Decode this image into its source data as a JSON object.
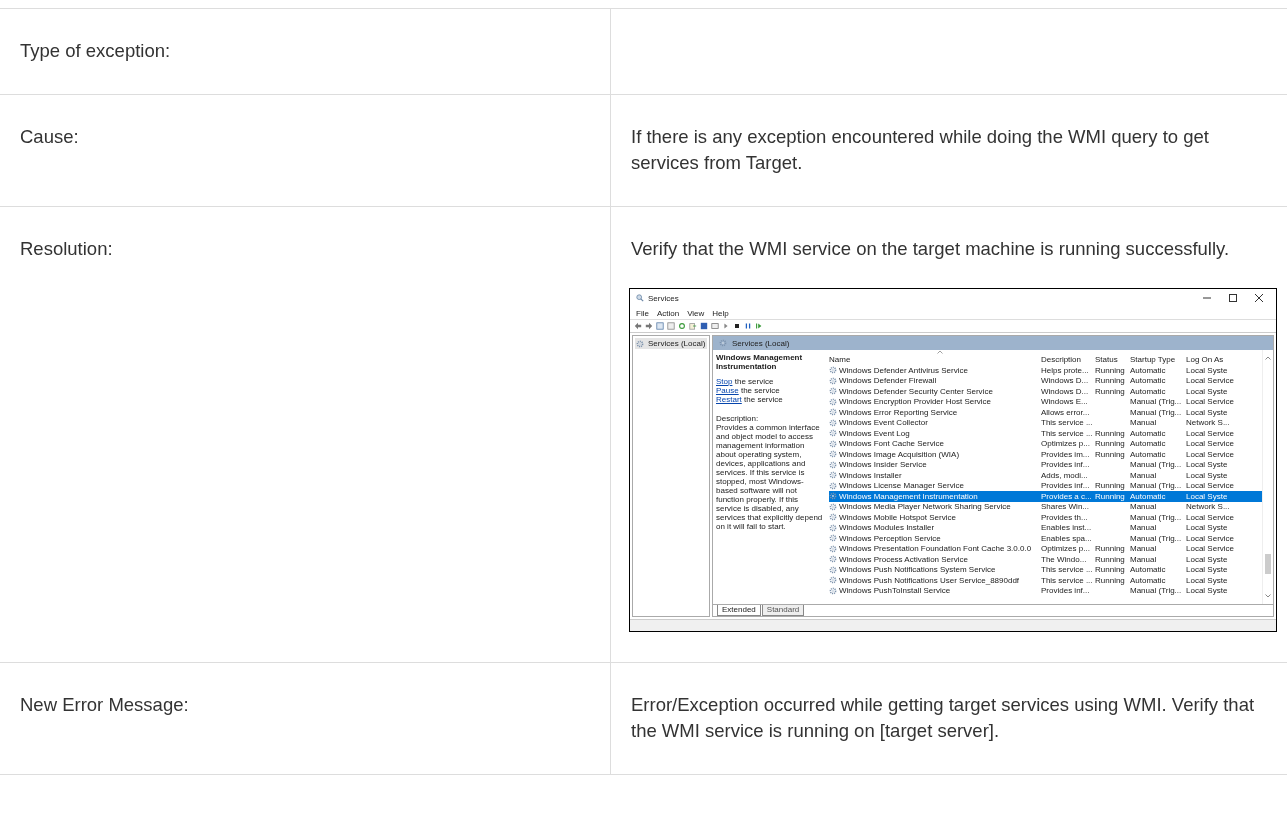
{
  "rows": [
    {
      "label": "Type of exception:"
    },
    {
      "label": "Cause:",
      "text": "If there is any exception encountered while doing the WMI query to get services from Target."
    },
    {
      "label": "Resolution:",
      "text": "Verify that the WMI service on the target machine is running successfully.",
      "screenshot": {
        "title": "Services",
        "menu": [
          "File",
          "Action",
          "View",
          "Help"
        ],
        "tree": [
          "Services (Local)"
        ],
        "header": "Services (Local)",
        "details": {
          "title": "Windows Management Instrumentation",
          "actions": [
            {
              "link": "Stop",
              "text": "the service"
            },
            {
              "link": "Pause",
              "text": "the service"
            },
            {
              "link": "Restart",
              "text": "the service"
            }
          ],
          "description_label": "Description:",
          "description": "Provides a common interface and object model to access management information about operating system, devices, applications and services. If this service is stopped, most Windows-based software will not function properly. If this service is disabled, any services that explicitly depend on it will fail to start."
        },
        "columns": [
          "Name",
          "Description",
          "Status",
          "Startup Type",
          "Log On As"
        ],
        "services": [
          {
            "name": "Windows Defender Antivirus Service",
            "description": "Helps prote...",
            "status": "Running",
            "startup": "Automatic",
            "logon": "Local Syste",
            "selected": false
          },
          {
            "name": "Windows Defender Firewall",
            "description": "Windows D...",
            "status": "Running",
            "startup": "Automatic",
            "logon": "Local Service",
            "selected": false
          },
          {
            "name": "Windows Defender Security Center Service",
            "description": "Windows D...",
            "status": "Running",
            "startup": "Automatic",
            "logon": "Local Syste",
            "selected": false
          },
          {
            "name": "Windows Encryption Provider Host Service",
            "description": "Windows E...",
            "startup": "Manual (Trig...",
            "logon": "Local Service",
            "selected": false
          },
          {
            "name": "Windows Error Reporting Service",
            "description": "Allows error...",
            "startup": "Manual (Trig...",
            "logon": "Local Syste",
            "selected": false
          },
          {
            "name": "Windows Event Collector",
            "description": "This service ...",
            "startup": "Manual",
            "logon": "Network S...",
            "selected": false
          },
          {
            "name": "Windows Event Log",
            "description": "This service ...",
            "status": "Running",
            "startup": "Automatic",
            "logon": "Local Service",
            "selected": false
          },
          {
            "name": "Windows Font Cache Service",
            "description": "Optimizes p...",
            "status": "Running",
            "startup": "Automatic",
            "logon": "Local Service",
            "selected": false
          },
          {
            "name": "Windows Image Acquisition (WIA)",
            "description": "Provides im...",
            "status": "Running",
            "startup": "Automatic",
            "logon": "Local Service",
            "selected": false
          },
          {
            "name": "Windows Insider Service",
            "description": "Provides inf...",
            "startup": "Manual (Trig...",
            "logon": "Local Syste",
            "selected": false
          },
          {
            "name": "Windows Installer",
            "description": "Adds, modi...",
            "startup": "Manual",
            "logon": "Local Syste",
            "selected": false
          },
          {
            "name": "Windows License Manager Service",
            "description": "Provides inf...",
            "status": "Running",
            "startup": "Manual (Trig...",
            "logon": "Local Service",
            "selected": false
          },
          {
            "name": "Windows Management Instrumentation",
            "description": "Provides a c...",
            "status": "Running",
            "startup": "Automatic",
            "logon": "Local Syste",
            "selected": true
          },
          {
            "name": "Windows Media Player Network Sharing Service",
            "description": "Shares Win...",
            "startup": "Manual",
            "logon": "Network S...",
            "selected": false
          },
          {
            "name": "Windows Mobile Hotspot Service",
            "description": "Provides th...",
            "startup": "Manual (Trig...",
            "logon": "Local Service",
            "selected": false
          },
          {
            "name": "Windows Modules Installer",
            "description": "Enables inst...",
            "startup": "Manual",
            "logon": "Local Syste",
            "selected": false
          },
          {
            "name": "Windows Perception Service",
            "description": "Enables spa...",
            "startup": "Manual (Trig...",
            "logon": "Local Service",
            "selected": false
          },
          {
            "name": "Windows Presentation Foundation Font Cache 3.0.0.0",
            "description": "Optimizes p...",
            "status": "Running",
            "startup": "Manual",
            "logon": "Local Service",
            "selected": false
          },
          {
            "name": "Windows Process Activation Service",
            "description": "The Windo...",
            "status": "Running",
            "startup": "Manual",
            "logon": "Local Syste",
            "selected": false
          },
          {
            "name": "Windows Push Notifications System Service",
            "description": "This service ...",
            "status": "Running",
            "startup": "Automatic",
            "logon": "Local Syste",
            "selected": false
          },
          {
            "name": "Windows Push Notifications User Service_8890ddf",
            "description": "This service ...",
            "status": "Running",
            "startup": "Automatic",
            "logon": "Local Syste",
            "selected": false
          },
          {
            "name": "Windows PushToInstall Service",
            "description": "Provides inf...",
            "startup": "Manual (Trig...",
            "logon": "Local Syste",
            "selected": false
          }
        ],
        "tabs": [
          {
            "label": "Extended",
            "selected": true
          },
          {
            "label": "Standard",
            "selected": false
          }
        ]
      }
    },
    {
      "label": "New Error Message:",
      "text": "Error/Exception occurred while getting target services using WMI. Verify that the WMI service is running on [target server]."
    }
  ]
}
